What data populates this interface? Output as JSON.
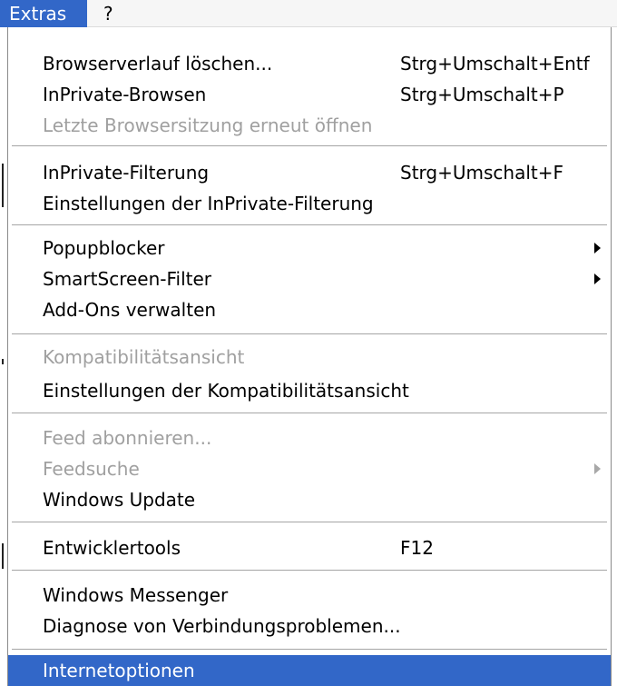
{
  "menubar": {
    "items": [
      {
        "label": "Extras",
        "active": true
      },
      {
        "label": "?",
        "active": false
      }
    ]
  },
  "menu": {
    "items": [
      {
        "label": "Browserverlauf löschen...",
        "shortcut": "Strg+Umschalt+Entf",
        "enabled": true
      },
      {
        "label": "InPrivate-Browsen",
        "shortcut": "Strg+Umschalt+P",
        "enabled": true
      },
      {
        "label": "Letzte Browsersitzung erneut öffnen",
        "shortcut": "",
        "enabled": false
      },
      {
        "label": "InPrivate-Filterung",
        "shortcut": "Strg+Umschalt+F",
        "enabled": true
      },
      {
        "label": "Einstellungen der InPrivate-Filterung",
        "shortcut": "",
        "enabled": true
      },
      {
        "label": "Popupblocker",
        "shortcut": "",
        "enabled": true,
        "submenu": true
      },
      {
        "label": "SmartScreen-Filter",
        "shortcut": "",
        "enabled": true,
        "submenu": true
      },
      {
        "label": "Add-Ons verwalten",
        "shortcut": "",
        "enabled": true
      },
      {
        "label": "Kompatibilitätsansicht",
        "shortcut": "",
        "enabled": false
      },
      {
        "label": "Einstellungen der Kompatibilitätsansicht",
        "shortcut": "",
        "enabled": true
      },
      {
        "label": "Feed abonnieren...",
        "shortcut": "",
        "enabled": false
      },
      {
        "label": "Feedsuche",
        "shortcut": "",
        "enabled": false,
        "submenu": true
      },
      {
        "label": "Windows Update",
        "shortcut": "",
        "enabled": true
      },
      {
        "label": "Entwicklertools",
        "shortcut": "F12",
        "enabled": true
      },
      {
        "label": "Windows Messenger",
        "shortcut": "",
        "enabled": true
      },
      {
        "label": "Diagnose von Verbindungsproblemen...",
        "shortcut": "",
        "enabled": true
      },
      {
        "label": "Internetoptionen",
        "shortcut": "",
        "enabled": true,
        "highlighted": true
      }
    ]
  },
  "colors": {
    "highlight": "#3267c8",
    "disabled_text": "#a0a0a0",
    "separator": "#a5a5a5"
  }
}
